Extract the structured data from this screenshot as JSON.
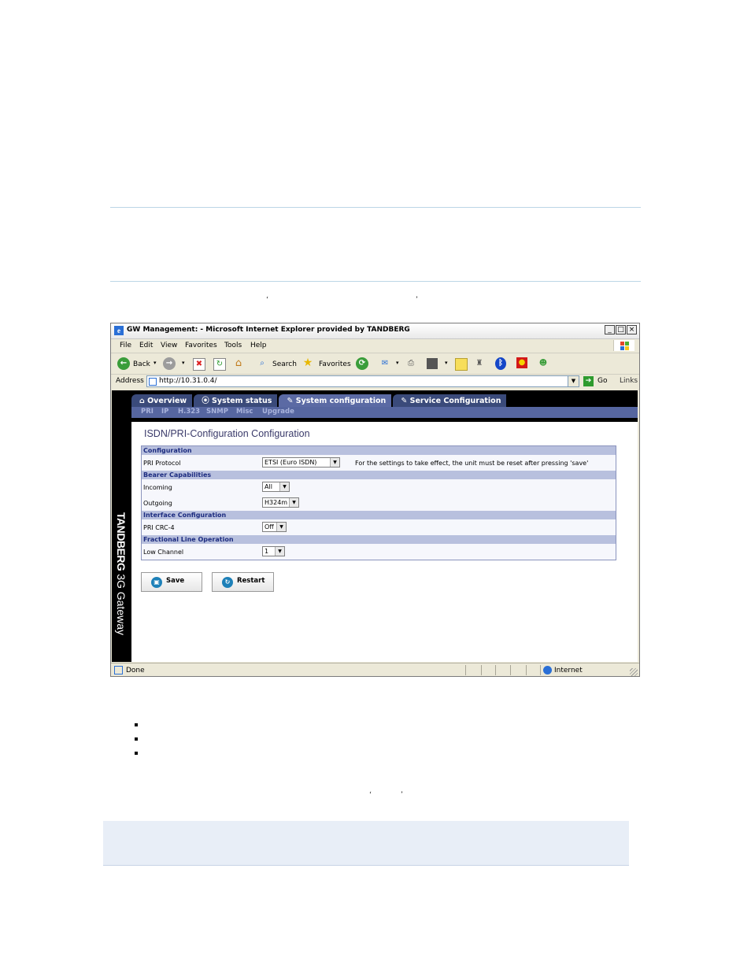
{
  "window": {
    "title": "GW Management: - Microsoft Internet Explorer provided by TANDBERG",
    "controls": [
      "_",
      "□",
      "×"
    ]
  },
  "menu": [
    "File",
    "Edit",
    "View",
    "Favorites",
    "Tools",
    "Help"
  ],
  "toolbar": {
    "back_label": "Back",
    "search_label": "Search",
    "favorites_label": "Favorites"
  },
  "address": {
    "label": "Address",
    "url": "http://10.31.0.4/",
    "go_label": "Go",
    "links_label": "Links"
  },
  "nav": {
    "tabs": [
      "Overview",
      "System status",
      "System configuration",
      "Service Configuration"
    ],
    "tab_icons": [
      "home-icon",
      "info-icon",
      "wrench-icon",
      "wrench-icon"
    ],
    "active_tab": "System configuration",
    "subnav": [
      "PRI",
      "IP",
      "H.323",
      "SNMP",
      "Misc",
      "Upgrade"
    ]
  },
  "sidebar": {
    "brand": "TANDBERG",
    "product": "3G Gateway"
  },
  "page": {
    "title": "ISDN/PRI-Configuration Configuration",
    "sections": {
      "configuration": "Configuration",
      "bearer": "Bearer Capabilities",
      "interface": "Interface Configuration",
      "fractional": "Fractional Line Operation"
    },
    "rows": {
      "pri_protocol_label": "PRI Protocol",
      "pri_protocol_value": "ETSI (Euro ISDN)",
      "pri_protocol_note": "For the settings to take effect, the unit must be reset after pressing 'save'",
      "incoming_label": "Incoming",
      "incoming_value": "All",
      "outgoing_label": "Outgoing",
      "outgoing_value": "H324m",
      "crc_label": "PRI CRC-4",
      "crc_value": "Off",
      "low_channel_label": "Low Channel",
      "low_channel_value": "1"
    },
    "buttons": {
      "save": "Save",
      "restart": "Restart"
    }
  },
  "status": {
    "text": "Done",
    "zone": "Internet"
  },
  "colors": {
    "accent": "#5666a0",
    "section_header": "#b8c0de",
    "rule": "#bcd6e6",
    "note_box": "#e8eef7"
  }
}
